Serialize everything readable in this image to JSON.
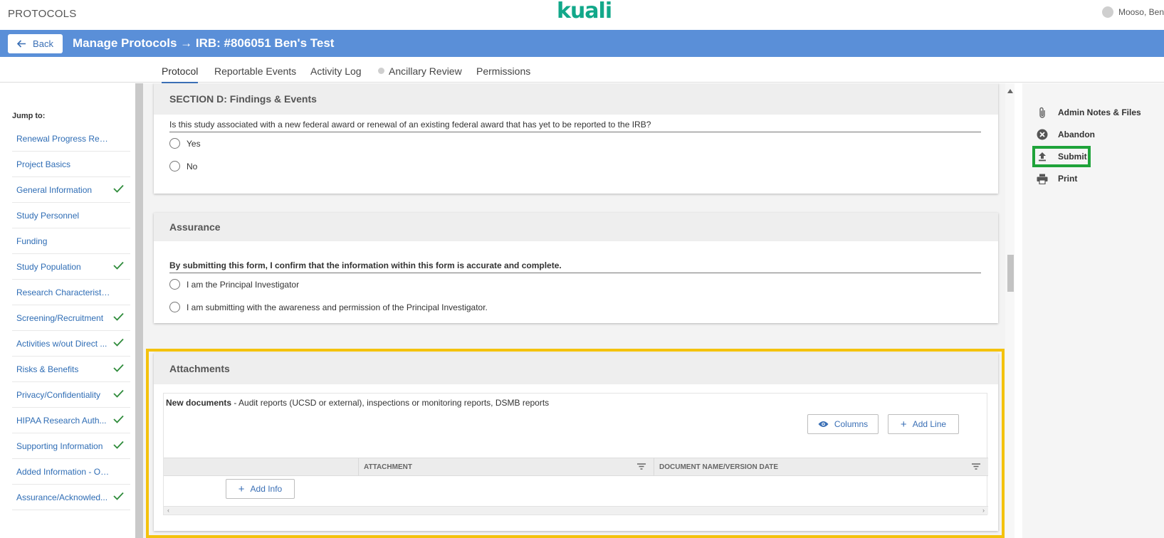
{
  "header": {
    "app_name": "PROTOCOLS",
    "logo": "kuali",
    "user_name": "Mooso, Ben"
  },
  "titlebar": {
    "back_label": "Back",
    "title": "Manage Protocols → IRB: #806051 Ben's Test"
  },
  "tabs": [
    {
      "label": "Protocol",
      "active": true
    },
    {
      "label": "Reportable Events"
    },
    {
      "label": "Activity Log"
    },
    {
      "label": "Ancillary Review",
      "status_dot": true
    },
    {
      "label": "Permissions"
    }
  ],
  "sidebar": {
    "jump_label": "Jump to:",
    "items": [
      {
        "label": "Renewal Progress Report",
        "complete": false
      },
      {
        "label": "Project Basics",
        "complete": false
      },
      {
        "label": "General Information",
        "complete": true
      },
      {
        "label": "Study Personnel",
        "complete": false
      },
      {
        "label": "Funding",
        "complete": false
      },
      {
        "label": "Study Population",
        "complete": true
      },
      {
        "label": "Research Characteristics",
        "complete": false
      },
      {
        "label": "Screening/Recruitment",
        "complete": true
      },
      {
        "label": "Activities w/out Direct ...",
        "complete": true
      },
      {
        "label": "Risks & Benefits",
        "complete": true
      },
      {
        "label": "Privacy/Confidentiality",
        "complete": true
      },
      {
        "label": "HIPAA Research Auth...",
        "complete": true
      },
      {
        "label": "Supporting Information",
        "complete": true
      },
      {
        "label": "Added Information - Optio...",
        "complete": false
      },
      {
        "label": "Assurance/Acknowled...",
        "complete": true
      }
    ]
  },
  "sections": {
    "findings": {
      "title": "SECTION D: Findings & Events",
      "question": "Is this study associated with a new federal award or renewal of an existing federal award that has yet to be reported to the IRB?",
      "options": [
        "Yes",
        "No"
      ]
    },
    "assurance": {
      "title": "Assurance",
      "question": "By submitting this form, I confirm that the information within this form is accurate and complete.",
      "options": [
        "I am the Principal Investigator",
        "I am submitting with the awareness and permission of the Principal Investigator."
      ]
    },
    "attachments": {
      "title": "Attachments",
      "doc_label": "New documents",
      "doc_description": " - Audit reports (UCSD or external), inspections or monitoring reports, DSMB reports",
      "columns_button": "Columns",
      "add_line_button": "Add Line",
      "col_attachment": "ATTACHMENT",
      "col_docname": "DOCUMENT NAME/VERSION DATE",
      "add_info_button": "Add Info"
    }
  },
  "actions": {
    "admin_notes": "Admin Notes & Files",
    "abandon": "Abandon",
    "submit": "Submit",
    "print": "Print"
  },
  "colors": {
    "brand": "#12a88a",
    "titlebar": "#5a8fd8",
    "link": "#2f6db5",
    "highlight_attachments": "#f4c20d",
    "highlight_submit": "#1fa33a",
    "check": "#2e8b3a"
  }
}
